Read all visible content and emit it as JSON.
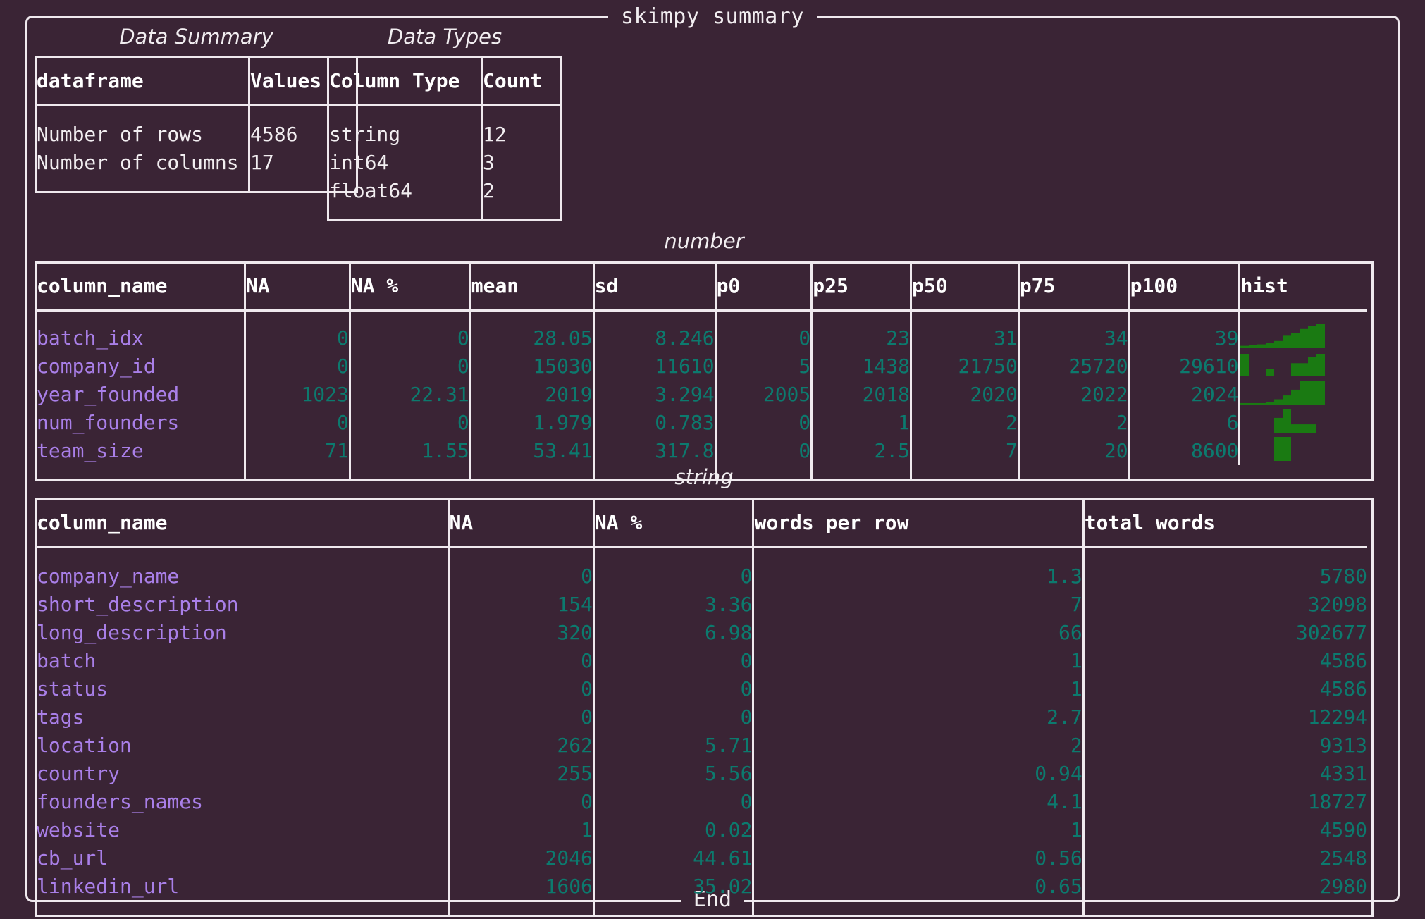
{
  "panel": {
    "title": "skimpy summary",
    "footer": "End"
  },
  "data_summary": {
    "caption": "Data Summary",
    "headers": [
      "dataframe",
      "Values"
    ],
    "rows": [
      [
        "Number of rows",
        "4586"
      ],
      [
        "Number of columns",
        "17"
      ]
    ]
  },
  "data_types": {
    "caption": "Data Types",
    "headers": [
      "Column Type",
      "Count"
    ],
    "rows": [
      [
        "string",
        "12"
      ],
      [
        "int64",
        "3"
      ],
      [
        "float64",
        "2"
      ]
    ]
  },
  "number": {
    "caption": "number",
    "headers": [
      "column_name",
      "NA",
      "NA %",
      "mean",
      "sd",
      "p0",
      "p25",
      "p50",
      "p75",
      "p100",
      "hist"
    ],
    "rows": [
      {
        "column_name": "batch_idx",
        "NA": "0",
        "NA_pct": "0",
        "mean": "28.05",
        "sd": "8.246",
        "p0": "0",
        "p25": "23",
        "p50": "31",
        "p75": "34",
        "p100": "39",
        "hist": [
          0.1,
          0.14,
          0.16,
          0.22,
          0.3,
          0.52,
          0.62,
          0.8,
          0.92,
          1.0
        ]
      },
      {
        "column_name": "company_id",
        "NA": "0",
        "NA_pct": "0",
        "mean": "15030",
        "sd": "11610",
        "p0": "5",
        "p25": "1438",
        "p50": "21750",
        "p75": "25720",
        "p100": "29610",
        "hist": [
          0.92,
          0.0,
          0.0,
          0.3,
          0.0,
          0.0,
          0.55,
          0.55,
          0.8,
          0.92
        ]
      },
      {
        "column_name": "year_founded",
        "NA": "1023",
        "NA_pct": "22.31",
        "mean": "2019",
        "sd": "3.294",
        "p0": "2005",
        "p25": "2018",
        "p50": "2020",
        "p75": "2022",
        "p100": "2024",
        "hist": [
          0.06,
          0.06,
          0.06,
          0.09,
          0.22,
          0.38,
          0.62,
          1.0,
          1.0,
          1.0
        ]
      },
      {
        "column_name": "num_founders",
        "NA": "0",
        "NA_pct": "0",
        "mean": "1.979",
        "sd": "0.783",
        "p0": "0",
        "p25": "1",
        "p50": "2",
        "p75": "2",
        "p100": "6",
        "hist": [
          0.0,
          0.0,
          0.0,
          0.0,
          0.62,
          1.0,
          0.35,
          0.35,
          0.35,
          0.0
        ]
      },
      {
        "column_name": "team_size",
        "NA": "71",
        "NA_pct": "1.55",
        "mean": "53.41",
        "sd": "317.8",
        "p0": "0",
        "p25": "2.5",
        "p50": "7",
        "p75": "20",
        "p100": "8600",
        "hist": [
          0.0,
          0.0,
          0.0,
          0.0,
          1.0,
          1.0,
          0.0,
          0.0,
          0.0,
          0.0
        ]
      }
    ]
  },
  "string": {
    "caption": "string",
    "headers": [
      "column_name",
      "NA",
      "NA %",
      "words per row",
      "total words"
    ],
    "rows": [
      {
        "column_name": "company_name",
        "NA": "0",
        "NA_pct": "0",
        "words_per_row": "1.3",
        "total_words": "5780"
      },
      {
        "column_name": "short_description",
        "NA": "154",
        "NA_pct": "3.36",
        "words_per_row": "7",
        "total_words": "32098"
      },
      {
        "column_name": "long_description",
        "NA": "320",
        "NA_pct": "6.98",
        "words_per_row": "66",
        "total_words": "302677"
      },
      {
        "column_name": "batch",
        "NA": "0",
        "NA_pct": "0",
        "words_per_row": "1",
        "total_words": "4586"
      },
      {
        "column_name": "status",
        "NA": "0",
        "NA_pct": "0",
        "words_per_row": "1",
        "total_words": "4586"
      },
      {
        "column_name": "tags",
        "NA": "0",
        "NA_pct": "0",
        "words_per_row": "2.7",
        "total_words": "12294"
      },
      {
        "column_name": "location",
        "NA": "262",
        "NA_pct": "5.71",
        "words_per_row": "2",
        "total_words": "9313"
      },
      {
        "column_name": "country",
        "NA": "255",
        "NA_pct": "5.56",
        "words_per_row": "0.94",
        "total_words": "4331"
      },
      {
        "column_name": "founders_names",
        "NA": "0",
        "NA_pct": "0",
        "words_per_row": "4.1",
        "total_words": "18727"
      },
      {
        "column_name": "website",
        "NA": "1",
        "NA_pct": "0.02",
        "words_per_row": "1",
        "total_words": "4590"
      },
      {
        "column_name": "cb_url",
        "NA": "2046",
        "NA_pct": "44.61",
        "words_per_row": "0.56",
        "total_words": "2548"
      },
      {
        "column_name": "linkedin_url",
        "NA": "1606",
        "NA_pct": "35.02",
        "words_per_row": "0.65",
        "total_words": "2980"
      }
    ]
  },
  "colors": {
    "background": "#3a2435",
    "border": "#efe9ee",
    "header_text": "#ffffff",
    "teal": "#0c7a6e",
    "purple": "#a97fe8",
    "hist_green": "#1a7a12"
  }
}
